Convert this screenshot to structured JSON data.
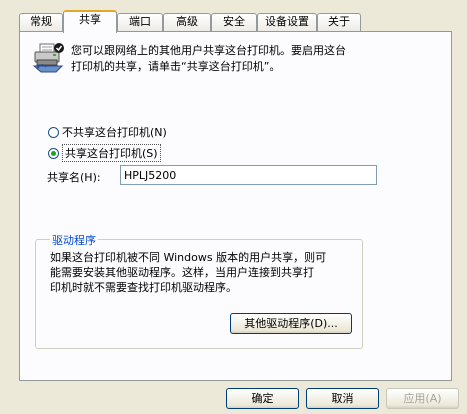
{
  "tabs": [
    {
      "label": "常规"
    },
    {
      "label": "共享"
    },
    {
      "label": "端口"
    },
    {
      "label": "高级"
    },
    {
      "label": "安全"
    },
    {
      "label": "设备设置"
    },
    {
      "label": "关于"
    }
  ],
  "active_tab": "共享",
  "sharing": {
    "description_line1": "您可以跟网络上的其他用户共享这台打印机。要启用这台",
    "description_line2": "打印机的共享，请单击“共享这台打印机”。",
    "option_not_share": "不共享这台打印机(N)",
    "option_share": "共享这台打印机(S)",
    "selected_option": "share",
    "share_name_label": "共享名(H):",
    "share_name_value": "HPLJ5200"
  },
  "drivers": {
    "legend": "驱动程序",
    "text_line1": "如果这台打印机被不同 Windows 版本的用户共享，则可",
    "text_line2": "能需要安装其他驱动程序。这样，当用户连接到共享打",
    "text_line3": "印机时就不需要查找打印机驱动程序。",
    "additional_drivers_button": "其他驱动程序(D)..."
  },
  "footer": {
    "ok_label": "确定",
    "cancel_label": "取消",
    "apply_label": "应用(A)"
  },
  "icons": {
    "printer": "shared-printer-icon"
  }
}
